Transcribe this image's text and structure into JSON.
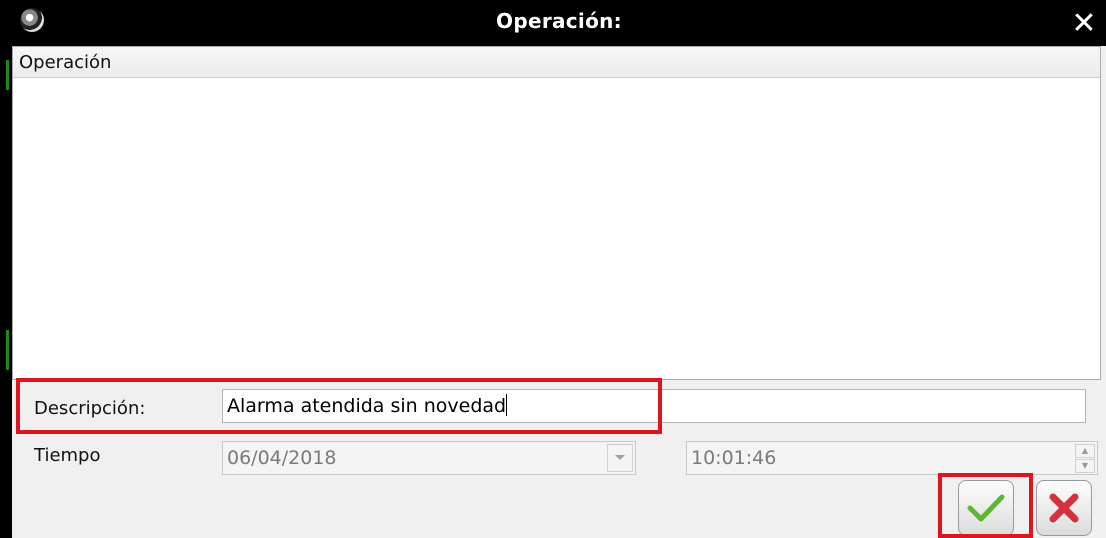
{
  "window": {
    "title": "Operación:",
    "close_glyph": "✕"
  },
  "grid": {
    "column_header": "Operación"
  },
  "form": {
    "description_label": "Descripción:",
    "description_value": "Alarma atendida sin novedad",
    "time_label": "Tiempo",
    "date_value": "06/04/2018",
    "time_value": "10:01:46"
  },
  "actions": {
    "accept_icon": "check-icon",
    "cancel_icon": "x-icon"
  },
  "colors": {
    "highlight": "#e0141e",
    "accept": "#5cb832",
    "cancel": "#d2323c"
  }
}
